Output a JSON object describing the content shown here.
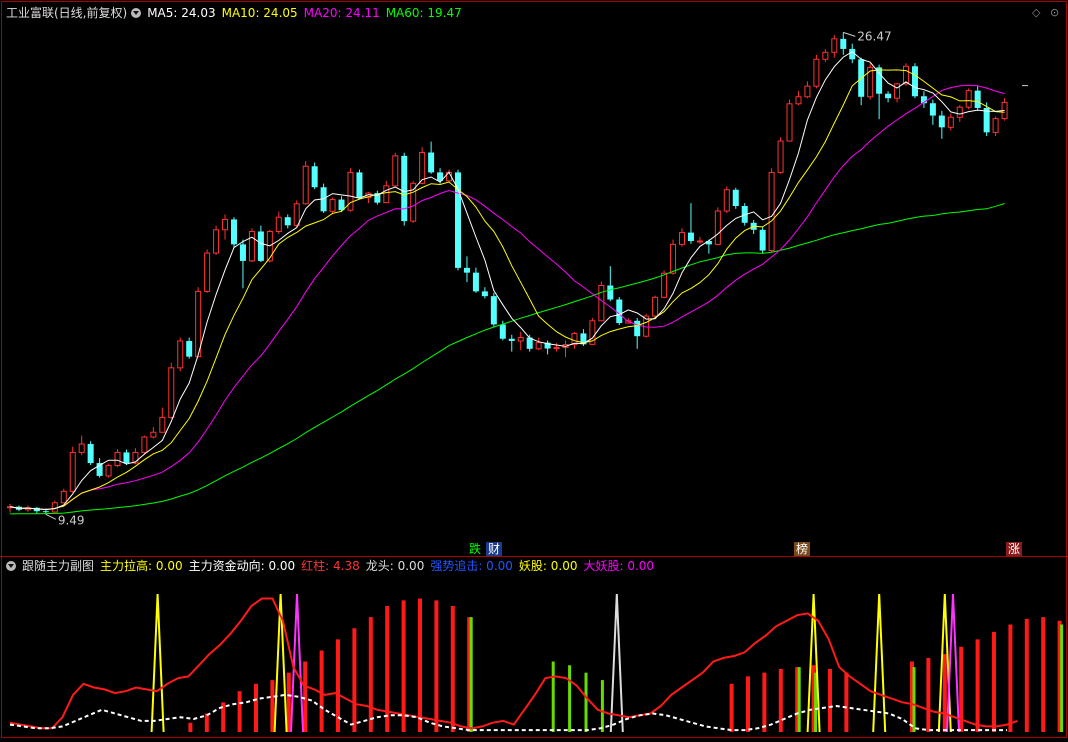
{
  "main_header": {
    "title": "工业富联(日线,前复权)",
    "ma5": "MA5: 24.03",
    "ma10": "MA10: 24.05",
    "ma20": "MA20: 24.11",
    "ma60": "MA60: 19.47"
  },
  "sub_header": {
    "title": "跟随主力副图",
    "zhuli_lagao": "主力拉高: 0.00",
    "zhuli_zijin": "主力资金动向: 0.00",
    "hongzhu": "红柱: 4.38",
    "longtou": "龙头: 0.00",
    "qiangshi": "强势追击: 0.00",
    "yaogu": "妖股: 0.00",
    "da_yaogu": "大妖股: 0.00"
  },
  "annotations": {
    "high_price": "26.47",
    "low_price": "9.49",
    "tag_die": "跌",
    "tag_cai": "财",
    "tag_bang": "榜",
    "tag_zhang": "涨"
  },
  "colors": {
    "up": "#ff3232",
    "down": "#54ffff",
    "ma5": "#ffffff",
    "ma10": "#ffff00",
    "ma20": "#ff00ff",
    "ma60": "#00ff00",
    "border": "#aa0000"
  },
  "chart_data": [
    {
      "type": "candlestick",
      "title": "工业富联(日线,前复权)",
      "y_range": [
        9.0,
        27.0
      ],
      "candles": [
        [
          9.76,
          9.76,
          9.86,
          9.55
        ],
        [
          9.76,
          9.65,
          9.8,
          9.6
        ],
        [
          9.65,
          9.72,
          9.8,
          9.58
        ],
        [
          9.72,
          9.6,
          9.75,
          9.52
        ],
        [
          9.6,
          9.57,
          9.7,
          9.49
        ],
        [
          9.57,
          9.9,
          9.98,
          9.55
        ],
        [
          9.9,
          10.31,
          10.4,
          9.88
        ],
        [
          10.31,
          11.7,
          11.9,
          10.26
        ],
        [
          11.7,
          12.0,
          12.3,
          11.6
        ],
        [
          12.0,
          11.32,
          12.1,
          11.25
        ],
        [
          11.32,
          10.86,
          11.5,
          10.8
        ],
        [
          10.86,
          11.23,
          11.3,
          10.8
        ],
        [
          11.23,
          11.7,
          11.82,
          11.18
        ],
        [
          11.7,
          11.32,
          11.8,
          11.25
        ],
        [
          11.32,
          11.7,
          11.85,
          11.28
        ],
        [
          11.7,
          12.25,
          12.3,
          11.65
        ],
        [
          12.25,
          12.42,
          12.6,
          12.2
        ],
        [
          12.42,
          12.95,
          13.3,
          12.4
        ],
        [
          12.95,
          14.72,
          14.9,
          12.9
        ],
        [
          14.72,
          15.68,
          15.8,
          14.6
        ],
        [
          15.68,
          15.12,
          15.8,
          15.05
        ],
        [
          15.12,
          17.45,
          17.6,
          15.1
        ],
        [
          17.45,
          18.82,
          18.95,
          17.4
        ],
        [
          18.82,
          19.65,
          19.8,
          18.75
        ],
        [
          19.65,
          20.02,
          20.2,
          19.3
        ],
        [
          20.02,
          19.13,
          20.1,
          19.0
        ],
        [
          19.13,
          18.54,
          19.3,
          17.56
        ],
        [
          18.54,
          19.59,
          19.7,
          18.5
        ],
        [
          19.59,
          18.54,
          19.8,
          18.5
        ],
        [
          18.54,
          19.59,
          19.65,
          18.48
        ],
        [
          19.59,
          20.1,
          20.3,
          19.5
        ],
        [
          20.1,
          19.81,
          20.2,
          19.7
        ],
        [
          19.81,
          20.58,
          20.7,
          19.75
        ],
        [
          20.58,
          21.92,
          22.1,
          20.55
        ],
        [
          21.92,
          21.17,
          22.05,
          21.1
        ],
        [
          21.17,
          20.31,
          21.3,
          20.25
        ],
        [
          20.31,
          20.73,
          20.8,
          20.2
        ],
        [
          20.73,
          20.35,
          20.85,
          20.28
        ],
        [
          20.35,
          21.7,
          21.85,
          20.3
        ],
        [
          21.7,
          20.8,
          21.8,
          20.75
        ],
        [
          20.8,
          20.96,
          21.0,
          20.6
        ],
        [
          20.96,
          20.62,
          21.05,
          20.55
        ],
        [
          20.62,
          21.22,
          21.4,
          20.6
        ],
        [
          21.22,
          22.29,
          22.4,
          21.18
        ],
        [
          22.29,
          19.96,
          22.4,
          19.8
        ],
        [
          19.96,
          21.31,
          21.4,
          19.9
        ],
        [
          21.31,
          22.41,
          22.6,
          21.28
        ],
        [
          22.41,
          21.7,
          22.8,
          21.65
        ],
        [
          21.7,
          21.4,
          21.85,
          21.3
        ],
        [
          21.4,
          21.7,
          21.8,
          21.35
        ],
        [
          21.7,
          18.29,
          21.8,
          18.2
        ],
        [
          18.29,
          18.12,
          18.7,
          17.78
        ],
        [
          18.12,
          17.45,
          18.3,
          17.4
        ],
        [
          17.45,
          17.28,
          17.6,
          17.2
        ],
        [
          17.28,
          16.27,
          17.4,
          16.2
        ],
        [
          16.27,
          15.76,
          16.4,
          15.7
        ],
        [
          15.76,
          15.68,
          15.9,
          15.3
        ],
        [
          15.68,
          15.8,
          16.0,
          15.35
        ],
        [
          15.8,
          15.4,
          15.9,
          15.3
        ],
        [
          15.4,
          15.62,
          15.8,
          15.35
        ],
        [
          15.62,
          15.41,
          15.7,
          15.2
        ],
        [
          15.41,
          15.45,
          15.6,
          15.3
        ],
        [
          15.45,
          15.55,
          15.7,
          15.1
        ],
        [
          15.55,
          15.95,
          16.0,
          15.4
        ],
        [
          15.95,
          15.56,
          16.1,
          15.5
        ],
        [
          15.56,
          16.4,
          16.5,
          15.55
        ],
        [
          16.4,
          17.66,
          17.8,
          16.4
        ],
        [
          17.66,
          17.16,
          18.35,
          17.1
        ],
        [
          17.16,
          16.32,
          17.25,
          16.25
        ],
        [
          16.32,
          16.4,
          16.5,
          16.3
        ],
        [
          16.4,
          15.85,
          16.5,
          15.4
        ],
        [
          15.85,
          16.57,
          16.65,
          15.8
        ],
        [
          16.57,
          17.24,
          17.3,
          16.5
        ],
        [
          17.24,
          18.1,
          18.2,
          17.2
        ],
        [
          18.1,
          19.13,
          19.3,
          18.05
        ],
        [
          19.13,
          19.55,
          19.7,
          19.05
        ],
        [
          19.55,
          19.25,
          20.6,
          19.15
        ],
        [
          19.25,
          19.25,
          19.4,
          19.15
        ],
        [
          19.25,
          19.13,
          19.3,
          18.8
        ],
        [
          19.13,
          20.32,
          20.45,
          19.1
        ],
        [
          20.32,
          21.08,
          21.2,
          20.25
        ],
        [
          21.08,
          20.5,
          21.15,
          20.4
        ],
        [
          20.5,
          19.9,
          20.6,
          19.8
        ],
        [
          19.9,
          19.65,
          20.0,
          19.5
        ],
        [
          19.65,
          18.91,
          19.75,
          18.8
        ],
        [
          18.91,
          21.7,
          21.85,
          18.85
        ],
        [
          21.7,
          22.82,
          22.95,
          21.65
        ],
        [
          22.82,
          24.15,
          24.3,
          22.8
        ],
        [
          24.15,
          24.4,
          24.6,
          24.1
        ],
        [
          24.4,
          24.78,
          24.95,
          24.35
        ],
        [
          24.78,
          25.74,
          25.9,
          24.7
        ],
        [
          25.74,
          25.99,
          26.1,
          25.65
        ],
        [
          25.99,
          26.47,
          26.6,
          25.8
        ],
        [
          26.47,
          26.11,
          26.7,
          25.9
        ],
        [
          26.11,
          25.74,
          26.3,
          25.6
        ],
        [
          25.74,
          24.4,
          25.8,
          24.1
        ],
        [
          24.4,
          25.45,
          25.6,
          24.3
        ],
        [
          25.45,
          24.51,
          25.55,
          23.6
        ],
        [
          24.51,
          24.35,
          24.6,
          24.2
        ],
        [
          24.35,
          24.86,
          24.9,
          24.2
        ],
        [
          24.86,
          25.49,
          25.6,
          24.8
        ],
        [
          25.49,
          24.42,
          25.6,
          24.35
        ],
        [
          24.42,
          24.17,
          24.6,
          24.0
        ],
        [
          24.17,
          23.73,
          24.3,
          23.4
        ],
        [
          23.73,
          23.31,
          23.9,
          22.9
        ],
        [
          23.31,
          23.67,
          23.8,
          23.2
        ],
        [
          23.67,
          24.03,
          24.1,
          23.5
        ],
        [
          24.03,
          24.62,
          24.7,
          23.95
        ],
        [
          24.62,
          24.0,
          24.8,
          23.9
        ],
        [
          24.0,
          23.13,
          24.2,
          23.0
        ],
        [
          23.13,
          23.62,
          23.7,
          23.0
        ],
        [
          23.62,
          24.2,
          24.35,
          23.55
        ]
      ],
      "series": [
        {
          "name": "MA5",
          "last": 24.03
        },
        {
          "name": "MA10",
          "last": 24.05
        },
        {
          "name": "MA20",
          "last": 24.11
        },
        {
          "name": "MA60",
          "last": 19.47
        }
      ],
      "annotations": [
        {
          "label": "26.47",
          "price": 26.47
        },
        {
          "label": "9.49",
          "price": 9.49
        }
      ]
    },
    {
      "type": "bar",
      "title": "跟随主力副图",
      "series": [
        {
          "name": "主力拉高",
          "last": 0.0
        },
        {
          "name": "主力资金动向",
          "last": 0.0
        },
        {
          "name": "红柱",
          "last": 4.38
        },
        {
          "name": "龙头",
          "last": 0.0
        },
        {
          "name": "强势追击",
          "last": 0.0
        },
        {
          "name": "妖股",
          "last": 0.0
        },
        {
          "name": "大妖股",
          "last": 0.0
        }
      ],
      "line": [
        0.5,
        0.4,
        0.3,
        0.2,
        0.2,
        0.8,
        2.0,
        2.6,
        2.4,
        2.3,
        2.1,
        2.2,
        2.4,
        2.3,
        2.2,
        2.6,
        2.9,
        3.0,
        3.6,
        4.2,
        4.7,
        5.3,
        6.0,
        6.8,
        7.2,
        7.2,
        6.0,
        3.5,
        2.5,
        2.3,
        2.0,
        2.1,
        1.8,
        1.5,
        1.4,
        1.2,
        1.1,
        1.0,
        0.9,
        0.8,
        0.7,
        0.6,
        0.5,
        0.3,
        0.2,
        0.3,
        0.5,
        0.6,
        0.4,
        1.2,
        2.0,
        2.9,
        3.0,
        2.9,
        2.5,
        1.8,
        1.2,
        1.0,
        0.9,
        0.8,
        0.9,
        1.0,
        1.4,
        2.0,
        2.4,
        2.8,
        3.2,
        3.8,
        4.0,
        4.1,
        4.3,
        4.8,
        5.2,
        5.7,
        6.0,
        6.3,
        6.4,
        6.0,
        5.0,
        3.5,
        3.0,
        2.6,
        2.2,
        2.0,
        1.8,
        1.6,
        1.5,
        1.3,
        1.1,
        1.0,
        0.8,
        0.6,
        0.4,
        0.3,
        0.3,
        0.4,
        0.6
      ],
      "dash_line": [
        0.4,
        0.3,
        0.2,
        0.2,
        0.3,
        0.6,
        0.9,
        1.2,
        1.0,
        0.8,
        0.6,
        0.6,
        0.7,
        0.8,
        0.7,
        0.9,
        1.3,
        1.5,
        1.6,
        1.8,
        1.9,
        2.0,
        1.9,
        1.7,
        1.2,
        0.8,
        0.4,
        0.6,
        0.8,
        0.9,
        0.9,
        0.8,
        0.5,
        0.3,
        0.2,
        0.1,
        0.1,
        0.1,
        0.1,
        0.1,
        0.1,
        0.1,
        0.1,
        0.1,
        0.1,
        0.2,
        0.4,
        0.7,
        0.9,
        1.0,
        0.9,
        0.7,
        0.5,
        0.3,
        0.2,
        0.1,
        0.1,
        0.2,
        0.4,
        0.7,
        1.0,
        1.2,
        1.3,
        1.4,
        1.3,
        1.2,
        1.1,
        1.0,
        0.7,
        0.2,
        0.1,
        0.1,
        0.1,
        0.1,
        0.1,
        0.1,
        0.1
      ],
      "red_bars": [
        [
          22,
          0.5
        ],
        [
          24,
          1.0
        ],
        [
          26,
          1.6
        ],
        [
          28,
          2.2
        ],
        [
          30,
          2.6
        ],
        [
          32,
          2.8
        ],
        [
          34,
          3.2
        ],
        [
          36,
          3.8
        ],
        [
          38,
          4.4
        ],
        [
          40,
          5.0
        ],
        [
          42,
          5.6
        ],
        [
          44,
          6.2
        ],
        [
          46,
          6.8
        ],
        [
          48,
          7.1
        ],
        [
          50,
          7.2
        ],
        [
          52,
          7.1
        ],
        [
          54,
          6.8
        ],
        [
          56,
          6.2
        ],
        [
          88,
          2.6
        ],
        [
          90,
          3.0
        ],
        [
          92,
          3.2
        ],
        [
          94,
          3.4
        ],
        [
          96,
          3.5
        ],
        [
          98,
          3.6
        ],
        [
          100,
          3.4
        ],
        [
          102,
          3.2
        ],
        [
          110,
          3.8
        ],
        [
          112,
          4.0
        ],
        [
          114,
          4.2
        ],
        [
          116,
          4.6
        ],
        [
          118,
          5.0
        ],
        [
          120,
          5.4
        ],
        [
          122,
          5.8
        ],
        [
          124,
          6.1
        ],
        [
          126,
          6.2
        ],
        [
          128,
          6.0
        ]
      ],
      "green_bars": [
        [
          56,
          6.2
        ],
        [
          66,
          3.8
        ],
        [
          68,
          3.6
        ],
        [
          70,
          3.2
        ],
        [
          72,
          2.8
        ],
        [
          96,
          3.5
        ],
        [
          98,
          3.2
        ],
        [
          110,
          3.5
        ],
        [
          128,
          5.8
        ]
      ],
      "yellow_spikes": [
        18,
        33,
        98,
        106,
        114
      ],
      "magenta_spikes": [
        35,
        115
      ],
      "white_spikes": [
        74
      ]
    }
  ]
}
